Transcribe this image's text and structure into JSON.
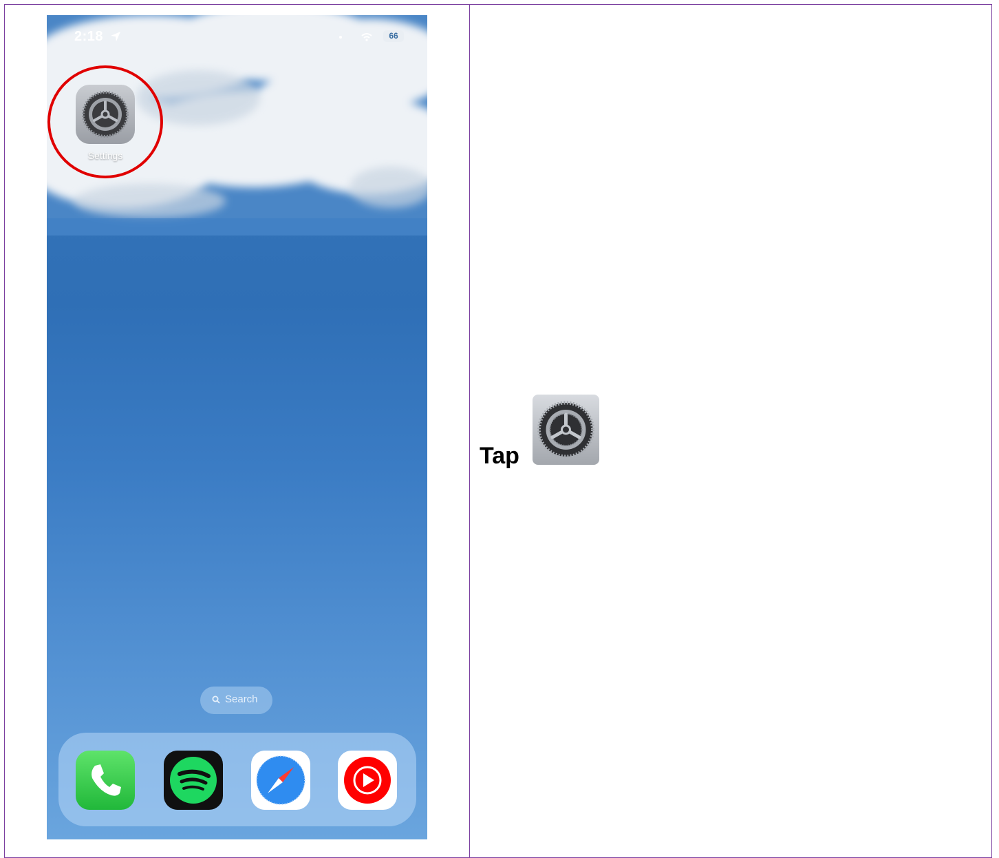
{
  "phone": {
    "status": {
      "time": "2:18",
      "battery": "66"
    },
    "home_apps": [
      {
        "name": "Settings"
      }
    ],
    "search_label": "Search",
    "dock_apps": [
      "phone-icon",
      "spotify-icon",
      "safari-icon",
      "youtube-music-icon"
    ]
  },
  "instruction": {
    "text": "Tap"
  },
  "colors": {
    "highlight": "#e00000",
    "border": "#7b3fa0",
    "sky": "#2f6fb6"
  }
}
